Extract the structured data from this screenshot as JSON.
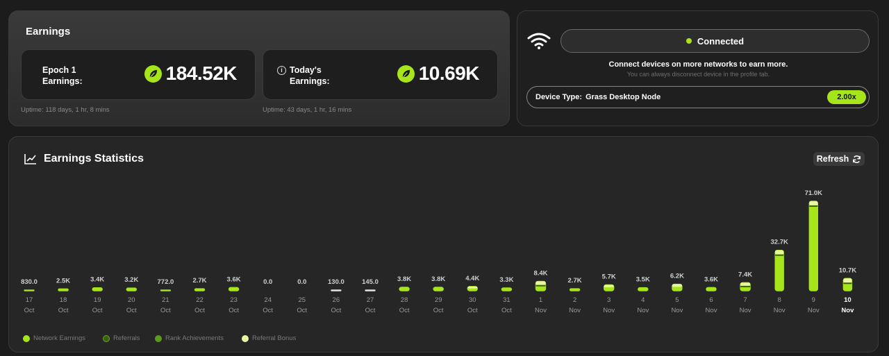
{
  "earnings": {
    "title": "Earnings",
    "epoch": {
      "label_line1": "Epoch 1",
      "label_line2": "Earnings:",
      "value": "184.52K",
      "uptime": "Uptime: 118 days, 1 hr, 8 mins"
    },
    "today": {
      "label_line1": "Today's",
      "label_line2": "Earnings:",
      "value": "10.69K",
      "uptime": "Uptime: 43 days, 1 hr, 16 mins"
    }
  },
  "network": {
    "status": "Connected",
    "connect_text": "Connect devices on more networks to earn more.",
    "connect_subtext": "You can always disconnect device in the profile tab.",
    "device_type_label": "Device Type:",
    "device_type_value": "Grass Desktop Node",
    "multiplier": "2.00x"
  },
  "stats": {
    "title": "Earnings Statistics",
    "refresh_label": "Refresh"
  },
  "colors": {
    "accent": "#a6e51a",
    "network_earnings": "#a6e51a",
    "referrals": "#4b7a16",
    "rank_achievements": "#5c9a1c",
    "referral_bonus": "#eaf7a0"
  },
  "chart_data": {
    "type": "bar",
    "categories": [
      {
        "day": "17",
        "month": "Oct"
      },
      {
        "day": "18",
        "month": "Oct"
      },
      {
        "day": "19",
        "month": "Oct"
      },
      {
        "day": "20",
        "month": "Oct"
      },
      {
        "day": "21",
        "month": "Oct"
      },
      {
        "day": "22",
        "month": "Oct"
      },
      {
        "day": "23",
        "month": "Oct"
      },
      {
        "day": "24",
        "month": "Oct"
      },
      {
        "day": "25",
        "month": "Oct"
      },
      {
        "day": "26",
        "month": "Oct"
      },
      {
        "day": "27",
        "month": "Oct"
      },
      {
        "day": "28",
        "month": "Oct"
      },
      {
        "day": "29",
        "month": "Oct"
      },
      {
        "day": "30",
        "month": "Oct"
      },
      {
        "day": "31",
        "month": "Oct"
      },
      {
        "day": "1",
        "month": "Nov"
      },
      {
        "day": "2",
        "month": "Nov"
      },
      {
        "day": "3",
        "month": "Nov"
      },
      {
        "day": "4",
        "month": "Nov"
      },
      {
        "day": "5",
        "month": "Nov"
      },
      {
        "day": "6",
        "month": "Nov"
      },
      {
        "day": "7",
        "month": "Nov"
      },
      {
        "day": "8",
        "month": "Nov"
      },
      {
        "day": "9",
        "month": "Nov"
      },
      {
        "day": "10",
        "month": "Nov"
      }
    ],
    "values": [
      830,
      2500,
      3400,
      3200,
      772,
      2700,
      3600,
      0,
      0,
      130,
      145,
      3800,
      3800,
      4400,
      3300,
      8400,
      2700,
      5700,
      3500,
      6200,
      3600,
      7400,
      32700,
      71000,
      10700
    ],
    "value_labels": [
      "830.0",
      "2.5K",
      "3.4K",
      "3.2K",
      "772.0",
      "2.7K",
      "3.6K",
      "0.0",
      "0.0",
      "130.0",
      "145.0",
      "3.8K",
      "3.8K",
      "4.4K",
      "3.3K",
      "8.4K",
      "2.7K",
      "5.7K",
      "3.5K",
      "6.2K",
      "3.6K",
      "7.4K",
      "32.7K",
      "71.0K",
      "10.7K"
    ],
    "highlighted_index": 24,
    "ylim": [
      0,
      71000
    ],
    "legend": [
      "Network Earnings",
      "Referrals",
      "Rank Achievements",
      "Referral Bonus"
    ],
    "legend_placement": "bottom-left",
    "grid": false
  }
}
